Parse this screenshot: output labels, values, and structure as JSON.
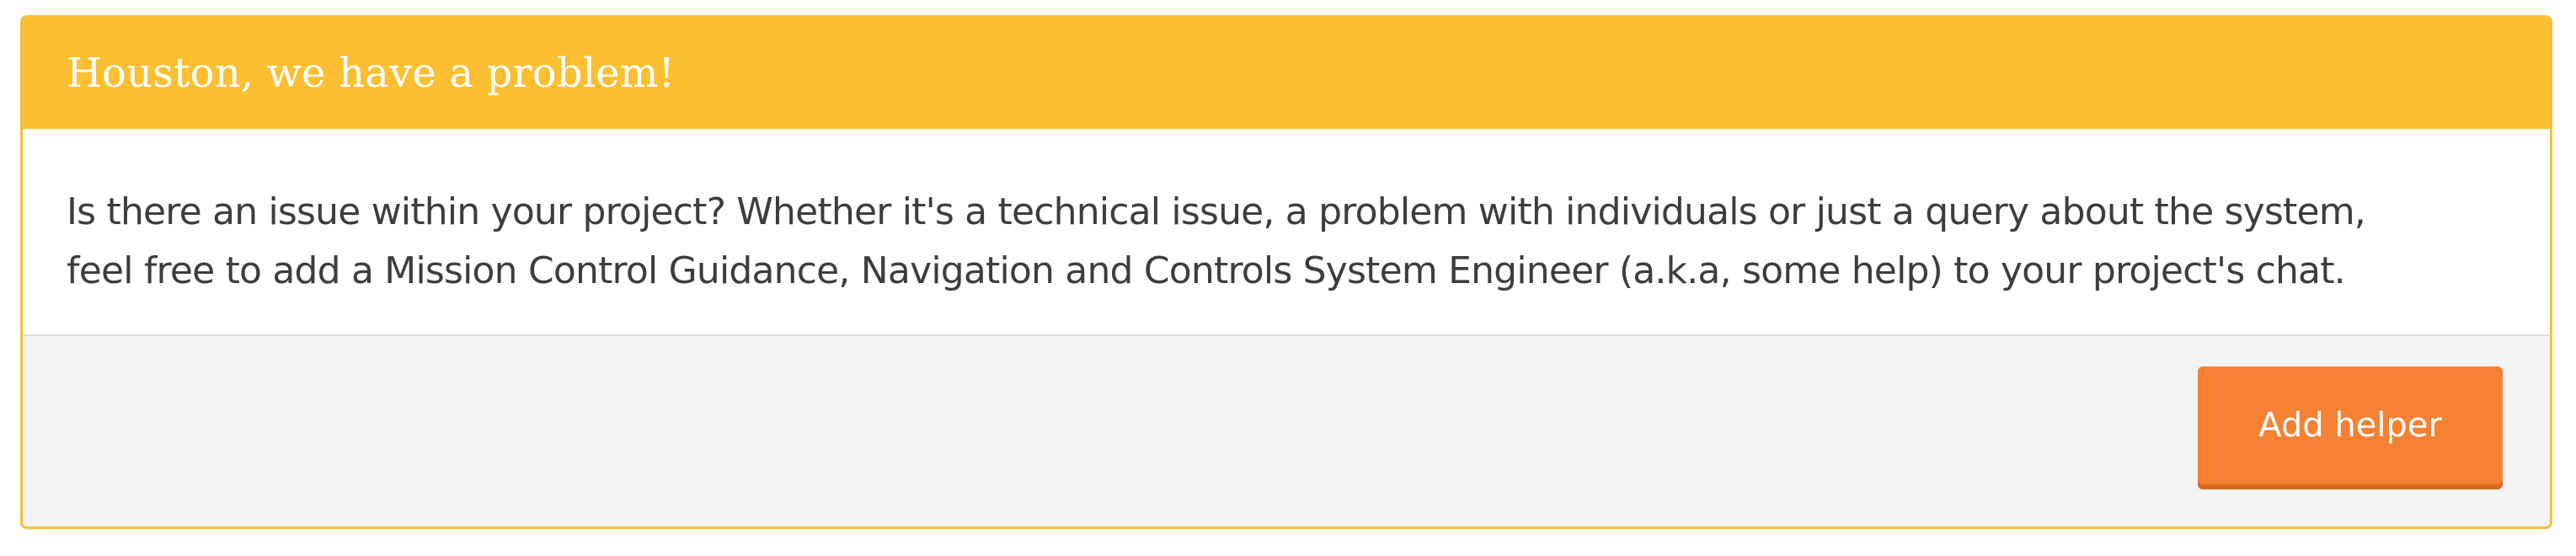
{
  "panel": {
    "title": "Houston, we have a problem!",
    "body_line_1": "Is there an issue within your project? Whether it's a technical issue, a problem with individuals or just a query about the system,",
    "body_line_2": "feel free to add a Mission Control Guidance, Navigation and Controls System Engineer (a.k.a, some help) to your project's chat.",
    "button_label": "Add helper"
  },
  "colors": {
    "header_bg": "#fcbf31",
    "border": "#f7be3a",
    "button_bg": "#f68133",
    "footer_bg": "#f4f4f4",
    "body_text": "#3d3d3d"
  }
}
